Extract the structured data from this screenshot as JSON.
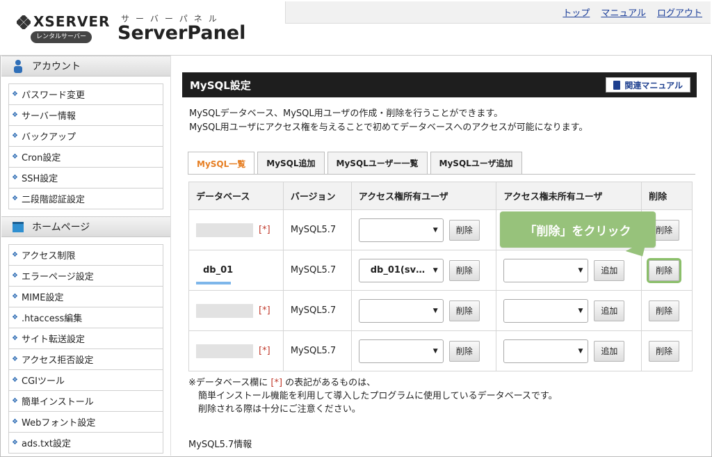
{
  "header": {
    "brand": "XSERVER",
    "rental_badge": "レンタルサーバー",
    "panel_kana": "サーバーパネル",
    "panel_name": "ServerPanel",
    "nav": [
      "トップ",
      "マニュアル",
      "ログアウト"
    ]
  },
  "sidebar": {
    "sections": [
      {
        "title": "アカウント",
        "icon": "person-icon",
        "items": [
          "パスワード変更",
          "サーバー情報",
          "バックアップ",
          "Cron設定",
          "SSH設定",
          "二段階認証設定"
        ]
      },
      {
        "title": "ホームページ",
        "icon": "window-icon",
        "items": [
          "アクセス制限",
          "エラーページ設定",
          "MIME設定",
          ".htaccess編集",
          "サイト転送設定",
          "アクセス拒否設定",
          "CGIツール",
          "簡単インストール",
          "Webフォント設定",
          "ads.txt設定"
        ]
      }
    ]
  },
  "main": {
    "title": "MySQL設定",
    "manual_button": "関連マニュアル",
    "desc_line1": "MySQLデータベース、MySQL用ユーザの作成・削除を行うことができます。",
    "desc_line2": "MySQL用ユーザにアクセス権を与えることで初めてデータベースへのアクセスが可能になります。",
    "tabs": [
      "MySQL一覧",
      "MySQL追加",
      "MySQLユーザー一覧",
      "MySQLユーザ追加"
    ],
    "table": {
      "headers": [
        "データベース",
        "バージョン",
        "アクセス権所有ユーザ",
        "アクセス権未所有ユーザ",
        "削除"
      ],
      "rows": [
        {
          "db": "",
          "version": "MySQL5.7",
          "owner_select": "",
          "nonowner_select": null
        },
        {
          "db": "db_01",
          "version": "MySQL5.7",
          "owner_select": "db_01(sv…",
          "nonowner_select": ""
        },
        {
          "db": "",
          "version": "MySQL5.7",
          "owner_select": "",
          "nonowner_select": ""
        },
        {
          "db": "",
          "version": "MySQL5.7",
          "owner_select": "",
          "nonowner_select": ""
        }
      ],
      "asterisk": "[*]",
      "delete_label": "削除",
      "add_label": "追加"
    },
    "callout": "「削除」をクリック",
    "note_line1_a": "※データベース欄に ",
    "note_line1_b": "[*]",
    "note_line1_c": " の表記があるものは、",
    "note_line2": "簡単インストール機能を利用して導入したプログラムに使用しているデータベースです。",
    "note_line3": "削除される際は十分にご注意ください。",
    "info_heading": "MySQL5.7情報"
  },
  "colors": {
    "title_bar": "#1e1e1e",
    "active_tab": "#e67e22",
    "callout": "#97c27b",
    "asterisk": "#c0392b",
    "link": "#1a3d99"
  }
}
